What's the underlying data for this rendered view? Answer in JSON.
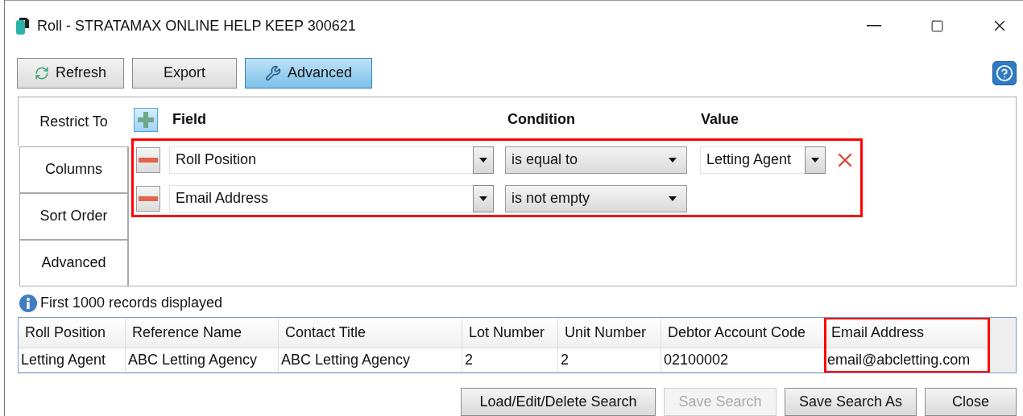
{
  "window": {
    "title": "Roll - STRATAMAX ONLINE HELP KEEP 300621"
  },
  "toolbar": [
    {
      "label": "Refresh",
      "kind": "refresh",
      "selected": false
    },
    {
      "label": "Export",
      "kind": "plain",
      "selected": false
    },
    {
      "label": "Advanced",
      "kind": "wrench",
      "selected": true
    }
  ],
  "tabs": [
    {
      "label": "Restrict To",
      "selected": true
    },
    {
      "label": "Columns",
      "selected": false
    },
    {
      "label": "Sort Order",
      "selected": false
    },
    {
      "label": "Advanced",
      "selected": false
    }
  ],
  "filter": {
    "headers": [
      "Field",
      "Condition",
      "Value"
    ],
    "highlighted": true,
    "rows": [
      {
        "field": "Roll Position",
        "condition": "is equal to",
        "value": "Letting Agent"
      },
      {
        "field": "Email Address",
        "condition": "is not empty"
      }
    ]
  },
  "info": "First 1000 records displayed",
  "table": {
    "columns": [
      {
        "label": "Roll Position",
        "highlighted": false
      },
      {
        "label": "Reference Name",
        "highlighted": false
      },
      {
        "label": "Contact Title",
        "highlighted": false
      },
      {
        "label": "Lot Number",
        "highlighted": false
      },
      {
        "label": "Unit Number",
        "highlighted": false
      },
      {
        "label": "Debtor Account Code",
        "highlighted": false
      },
      {
        "label": "Email Address",
        "highlighted": true
      }
    ],
    "rows": [
      [
        "Letting Agent",
        "ABC Letting Agency",
        "ABC Letting Agency",
        "2",
        "2",
        "02100002",
        "email@abcletting.com"
      ]
    ]
  },
  "buttons": [
    {
      "label": "Load/Edit/Delete Search",
      "disabled": false
    },
    {
      "label": "Save Search",
      "disabled": true
    },
    {
      "label": "Save Search As",
      "disabled": false
    },
    {
      "label": "Close",
      "disabled": false
    }
  ]
}
